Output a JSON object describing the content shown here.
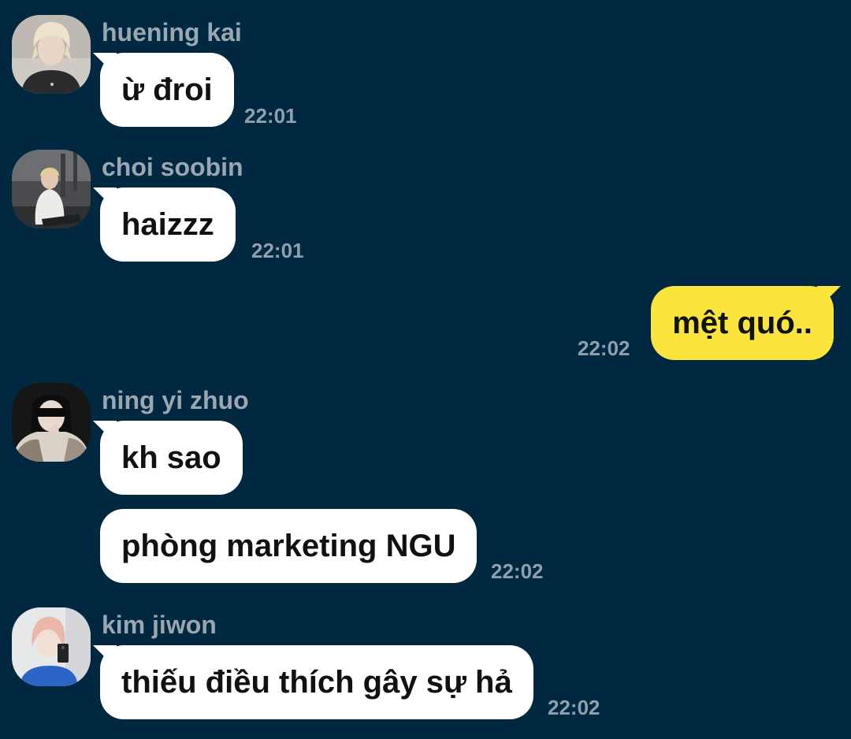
{
  "messages": [
    {
      "sender": "huening kai",
      "text": "ừ đroi",
      "time": "22:01"
    },
    {
      "sender": "choi soobin",
      "text": "haizzz",
      "time": "22:01"
    },
    {
      "text": "mệt quó..",
      "time": "22:02"
    },
    {
      "sender": "ning yi zhuo",
      "text": "kh sao"
    },
    {
      "text": "phòng marketing NGU",
      "time": "22:02"
    },
    {
      "sender": "kim jiwon",
      "text": "thiếu điều thích gây sự hả",
      "time": "22:02"
    }
  ],
  "colors": {
    "background": "#012841",
    "incoming_bubble": "#ffffff",
    "outgoing_bubble": "#fbe53c",
    "sender_name": "#9aa6b0",
    "timestamp": "#8fa0ac"
  },
  "icons": {
    "avatar_huening_kai": "user-photo-avatar",
    "avatar_choi_soobin": "user-photo-avatar",
    "avatar_ning_yi_zhuo": "user-photo-avatar",
    "avatar_kim_jiwon": "user-photo-avatar"
  }
}
